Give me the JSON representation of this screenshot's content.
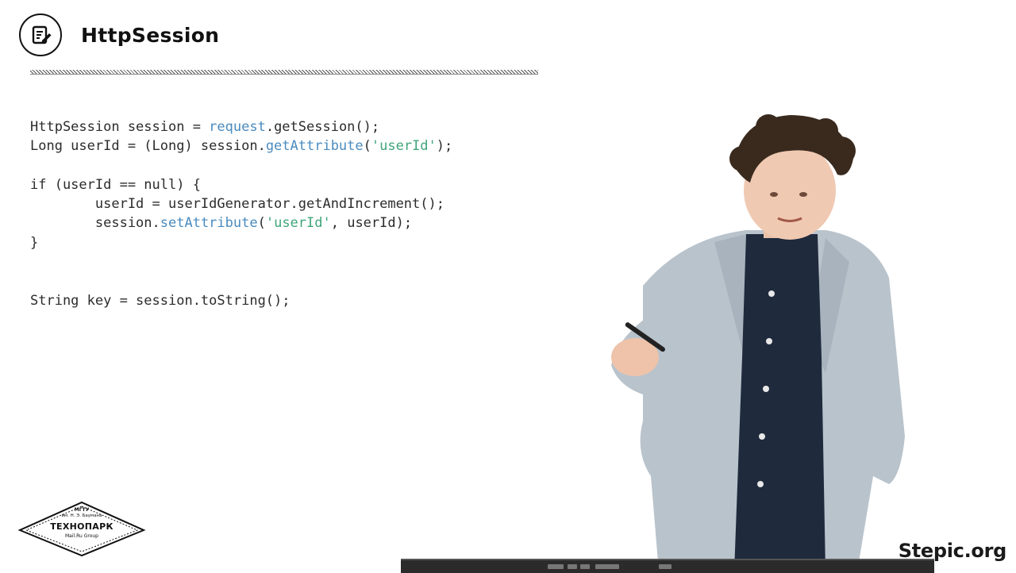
{
  "slide": {
    "title": "HttpSession",
    "title_icon": "document-edit-icon"
  },
  "code": {
    "lines": [
      [
        {
          "t": "HttpSession session = ",
          "c": "plain"
        },
        {
          "t": "request",
          "c": "blue"
        },
        {
          "t": ".getSession();",
          "c": "plain"
        }
      ],
      [
        {
          "t": "Long userId = (Long) session.",
          "c": "plain"
        },
        {
          "t": "getAttribute",
          "c": "blue"
        },
        {
          "t": "(",
          "c": "plain"
        },
        {
          "t": "'userId'",
          "c": "str"
        },
        {
          "t": ");",
          "c": "plain"
        }
      ],
      [],
      [
        {
          "t": "if (userId == null) {",
          "c": "plain"
        }
      ],
      [
        {
          "t": "        userId = userIdGenerator.getAndIncrement();",
          "c": "plain"
        }
      ],
      [
        {
          "t": "        session.",
          "c": "plain"
        },
        {
          "t": "setAttribute",
          "c": "blue"
        },
        {
          "t": "(",
          "c": "plain"
        },
        {
          "t": "'userId'",
          "c": "str"
        },
        {
          "t": ", userId);",
          "c": "plain"
        }
      ],
      [
        {
          "t": "}",
          "c": "plain"
        }
      ],
      [],
      [],
      [
        {
          "t": "String key = session.toString();",
          "c": "plain"
        }
      ]
    ]
  },
  "logo": {
    "line1": "МГТУ",
    "line2": "им. Н. Э. Баумана",
    "line3": "ТЕХНОПАРК",
    "line4": "Mail.Ru Group"
  },
  "watermark": "Stepic.org",
  "colors": {
    "code_text": "#2c2c2c",
    "code_keyword": "#4a8bbf",
    "code_string": "#3fa57a",
    "jacket": "#b9c3cc",
    "shirt": "#1f2a3d",
    "hair": "#3a2a1e"
  }
}
